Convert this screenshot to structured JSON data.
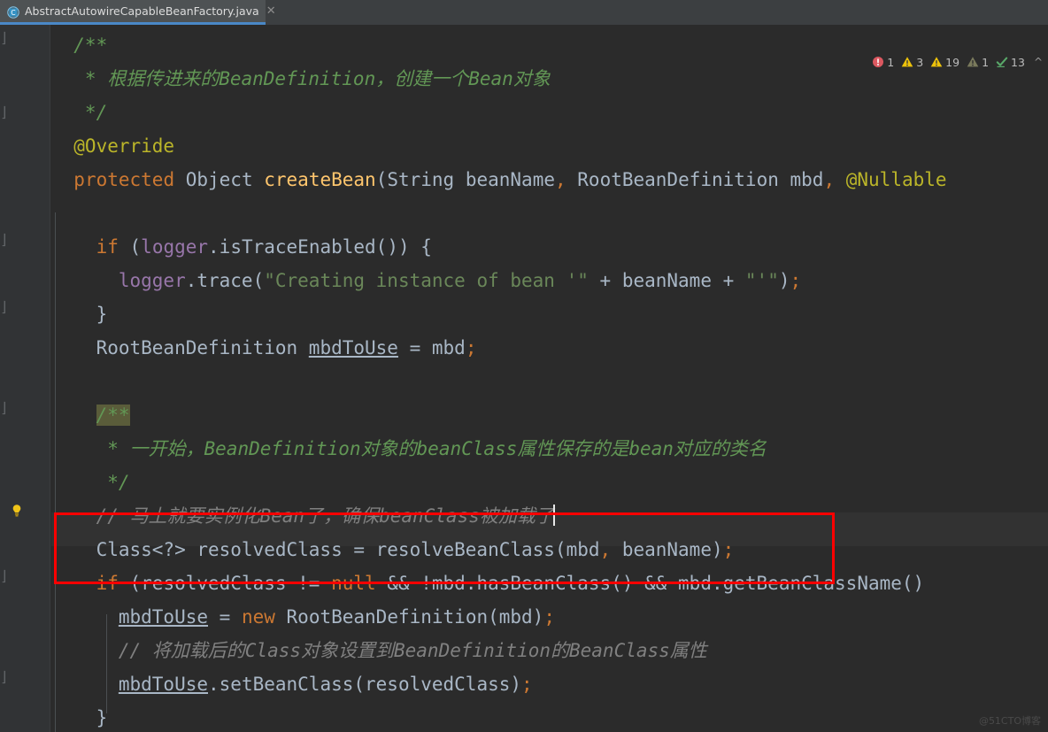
{
  "window": {
    "title": "AbstractAutowireCapableBeanFactory.java"
  },
  "tabs": [
    {
      "label": "AbstractAutowireCapableBeanFactory.java",
      "icon": "java-class-icon",
      "close_icon": "close-icon",
      "active": true
    }
  ],
  "inspections": {
    "items": [
      {
        "icon": "error-icon",
        "count": "1",
        "color": "#db5860"
      },
      {
        "icon": "warning-icon",
        "count": "3",
        "color": "#edc20a"
      },
      {
        "icon": "warning-icon",
        "count": "19",
        "color": "#edc20a"
      },
      {
        "icon": "weak-warning-icon",
        "count": "1",
        "color": "#7a7a5c"
      },
      {
        "icon": "inspection-ok-icon",
        "count": "13",
        "color": "#59a869"
      }
    ],
    "chevron": "chevron-up-icon"
  },
  "gutter": {
    "bulb_icon": "intention-bulb-icon",
    "fold_icon": "fold-region-icon"
  },
  "code": {
    "lines": [
      {
        "n": 0,
        "tokens": [
          {
            "t": "  /**",
            "c": "cmt"
          }
        ]
      },
      {
        "n": 1,
        "tokens": [
          {
            "t": "   * 根据传进来的",
            "c": "cmt"
          },
          {
            "t": "BeanDefinition",
            "c": "cmt"
          },
          {
            "t": "，创建一个",
            "c": "cmt"
          },
          {
            "t": "Bean",
            "c": "cmt"
          },
          {
            "t": "对象",
            "c": "cmt"
          }
        ]
      },
      {
        "n": 2,
        "tokens": [
          {
            "t": "   */",
            "c": "cmt"
          }
        ]
      },
      {
        "n": 3,
        "tokens": [
          {
            "t": "  @Override",
            "c": "anno"
          }
        ]
      },
      {
        "n": 4,
        "tokens": [
          {
            "t": "  ",
            "c": "txt"
          },
          {
            "t": "protected",
            "c": "kw"
          },
          {
            "t": " Object ",
            "c": "txt"
          },
          {
            "t": "createBean",
            "c": "fn"
          },
          {
            "t": "(String beanName",
            "c": "txt"
          },
          {
            "t": ",",
            "c": "kw"
          },
          {
            "t": " RootBeanDefinition mbd",
            "c": "txt"
          },
          {
            "t": ",",
            "c": "kw"
          },
          {
            "t": " ",
            "c": "txt"
          },
          {
            "t": "@Nullable",
            "c": "anno"
          },
          {
            "t": " ",
            "c": "txt"
          }
        ]
      },
      {
        "n": 5,
        "tokens": []
      },
      {
        "n": 6,
        "tokens": [
          {
            "t": "    ",
            "c": "txt"
          },
          {
            "t": "if",
            "c": "kw"
          },
          {
            "t": " (",
            "c": "txt"
          },
          {
            "t": "logger",
            "c": "field"
          },
          {
            "t": ".isTraceEnabled()) {",
            "c": "txt"
          }
        ]
      },
      {
        "n": 7,
        "tokens": [
          {
            "t": "      ",
            "c": "txt"
          },
          {
            "t": "logger",
            "c": "field"
          },
          {
            "t": ".trace(",
            "c": "txt"
          },
          {
            "t": "\"Creating instance of bean '\"",
            "c": "str"
          },
          {
            "t": " + beanName + ",
            "c": "txt"
          },
          {
            "t": "\"'\"",
            "c": "str"
          },
          {
            "t": ")",
            "c": "txt"
          },
          {
            "t": ";",
            "c": "kw"
          }
        ]
      },
      {
        "n": 8,
        "tokens": [
          {
            "t": "    }",
            "c": "txt"
          }
        ]
      },
      {
        "n": 9,
        "tokens": [
          {
            "t": "    RootBeanDefinition ",
            "c": "txt"
          },
          {
            "t": "mbdToUse",
            "c": "txt ul"
          },
          {
            "t": " = mbd",
            "c": "txt"
          },
          {
            "t": ";",
            "c": "kw"
          }
        ]
      },
      {
        "n": 10,
        "tokens": []
      },
      {
        "n": 11,
        "tokens": [
          {
            "t": "    ",
            "c": "txt"
          },
          {
            "t": "/**",
            "c": "cmt hl"
          }
        ]
      },
      {
        "n": 12,
        "tokens": [
          {
            "t": "     * 一开始，",
            "c": "cmt"
          },
          {
            "t": "BeanDefinition",
            "c": "cmt"
          },
          {
            "t": "对象的",
            "c": "cmt"
          },
          {
            "t": "beanClass",
            "c": "cmt"
          },
          {
            "t": "属性保存的是",
            "c": "cmt"
          },
          {
            "t": "bean",
            "c": "cmt"
          },
          {
            "t": "对应的类名",
            "c": "cmt"
          }
        ]
      },
      {
        "n": 13,
        "tokens": [
          {
            "t": "     */",
            "c": "cmt"
          }
        ]
      },
      {
        "n": 14,
        "tokens": [
          {
            "t": "    // 马上就要实例化Bean了，确保beanClass被加载了",
            "c": "cmt-pl"
          }
        ],
        "caret_row": true,
        "caret": true
      },
      {
        "n": 15,
        "tokens": [
          {
            "t": "    Class<?> resolvedClass = resolveBeanClass(mbd",
            "c": "txt"
          },
          {
            "t": ",",
            "c": "kw"
          },
          {
            "t": " beanName)",
            "c": "txt"
          },
          {
            "t": ";",
            "c": "kw"
          }
        ]
      },
      {
        "n": 16,
        "tokens": [
          {
            "t": "    ",
            "c": "txt"
          },
          {
            "t": "if",
            "c": "kw"
          },
          {
            "t": " (resolvedClass != ",
            "c": "txt"
          },
          {
            "t": "null",
            "c": "kw"
          },
          {
            "t": " && !mbd.hasBeanClass() && mbd.getBeanClassName()",
            "c": "txt"
          }
        ]
      },
      {
        "n": 17,
        "tokens": [
          {
            "t": "      ",
            "c": "txt"
          },
          {
            "t": "mbdToUse",
            "c": "txt ul"
          },
          {
            "t": " = ",
            "c": "txt"
          },
          {
            "t": "new",
            "c": "kw"
          },
          {
            "t": " RootBeanDefinition(mbd)",
            "c": "txt"
          },
          {
            "t": ";",
            "c": "kw"
          }
        ]
      },
      {
        "n": 18,
        "tokens": [
          {
            "t": "      // 将加载后的Class对象设置到BeanDefinition的BeanClass属性",
            "c": "cmt-pl"
          }
        ]
      },
      {
        "n": 19,
        "tokens": [
          {
            "t": "      ",
            "c": "txt"
          },
          {
            "t": "mbdToUse",
            "c": "txt ul"
          },
          {
            "t": ".setBeanClass(resolvedClass)",
            "c": "txt"
          },
          {
            "t": ";",
            "c": "kw"
          }
        ]
      },
      {
        "n": 20,
        "tokens": [
          {
            "t": "    }",
            "c": "txt"
          }
        ]
      }
    ]
  },
  "annotation": {
    "redbox_label": "highlighted-code-region"
  },
  "watermark": {
    "text": "@51CTO博客"
  }
}
